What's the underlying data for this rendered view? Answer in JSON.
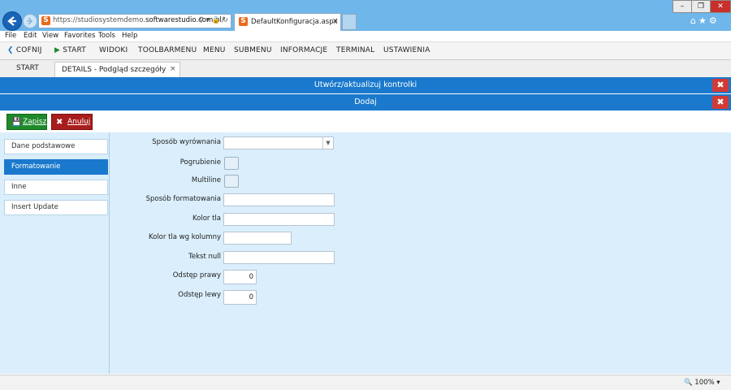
{
  "browser": {
    "url_prefix": "https://studiosystemdemo.",
    "url_domain": "softwarestudio.com.pl",
    "url_suffix": "/",
    "addr_icons": "⚲ ▾ 🔒 ↻",
    "tab_title": "DefaultKonfiguracja.aspx",
    "tab_close": "×",
    "site_icon": "S",
    "win_min": "–",
    "win_max": "❐",
    "win_close": "✕",
    "tb_icons": "⌂★⚙",
    "menu": [
      "File",
      "Edit",
      "View",
      "Favorites",
      "Tools",
      "Help"
    ]
  },
  "toolbar": {
    "back": "COFNIJ",
    "start": "START",
    "items": [
      "WIDOKI",
      "TOOLBARMENU",
      "MENU",
      "SUBMENU",
      "INFORMACJE",
      "TERMINAL",
      "USTAWIENIA"
    ]
  },
  "tabs": {
    "start": "START",
    "details": "DETAILS - Podgląd szczegóły",
    "details_close": "×"
  },
  "headers": {
    "primary": "Utwórz/aktualizuj kontrolki",
    "secondary": "Dodaj",
    "close": "✖"
  },
  "actions": {
    "save": "Zapisz",
    "cancel": "Anuluj"
  },
  "sidebar": {
    "items": [
      "Dane podstawowe",
      "Formatowanie",
      "Inne",
      "Insert Update"
    ]
  },
  "form": {
    "labels": {
      "alignment": "Sposób wyrównania",
      "bold": "Pogrubienie",
      "multiline": "Multiline",
      "format": "Sposób formatowania",
      "bgcolor": "Kolor tla",
      "bgcolor_column": "Kolor tla wg kolumny",
      "null_text": "Tekst null",
      "right_spacing": "Odstęp prawy",
      "left_spacing": "Odstęp lewy"
    },
    "values": {
      "right_spacing": "0",
      "left_spacing": "0"
    }
  },
  "status": {
    "zoom": "🔍 100%  ▾"
  },
  "colors": {
    "header_blue": "#1a79cc",
    "save_green": "#1e8a2a",
    "cancel_red": "#a81d1d",
    "close_red": "#d23a36",
    "panel_bg": "#daeefb"
  }
}
